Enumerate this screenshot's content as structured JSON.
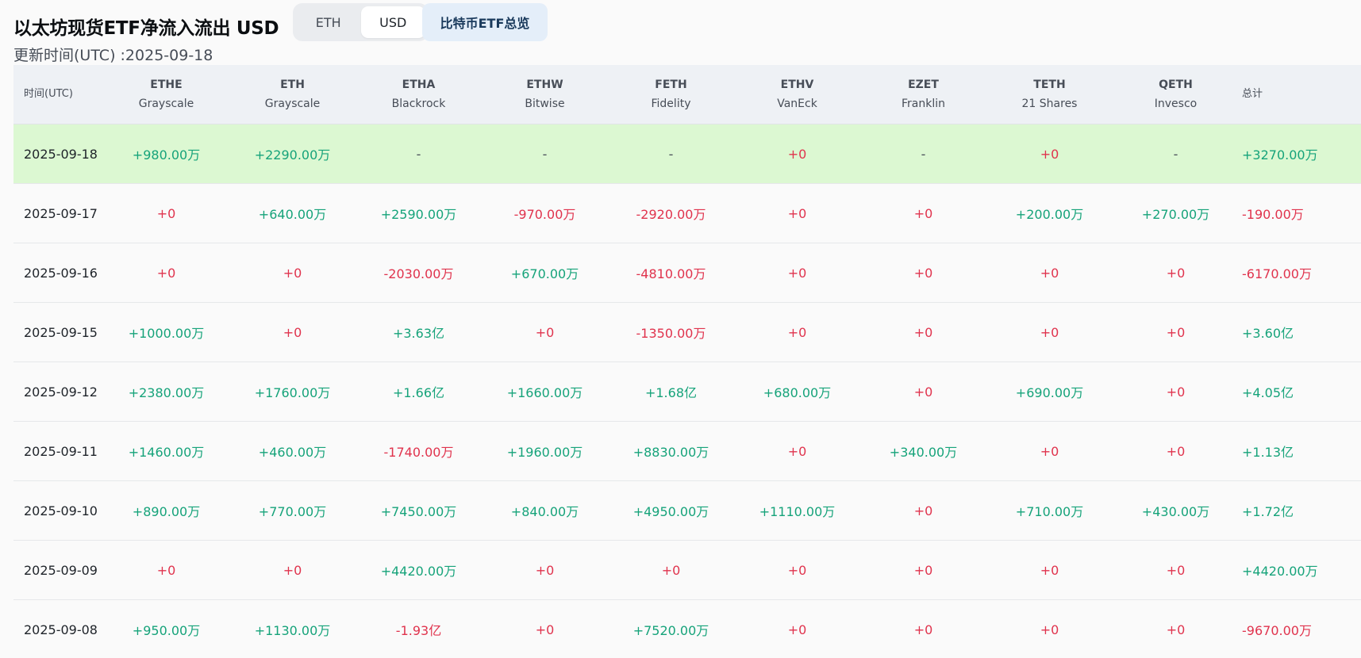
{
  "header": {
    "title": "以太坊现货ETF净流入流出 USD",
    "toggle": {
      "eth_label": "ETH",
      "usd_label": "USD",
      "active": "USD"
    },
    "btc_button_label": "比特币ETF总览",
    "updated_label": "更新时间(UTC) :2025-09-18"
  },
  "table": {
    "date_header": "时间(UTC)",
    "total_header": "总计",
    "columns": [
      {
        "ticker": "ETHE",
        "issuer": "Grayscale"
      },
      {
        "ticker": "ETH",
        "issuer": "Grayscale"
      },
      {
        "ticker": "ETHA",
        "issuer": "Blackrock"
      },
      {
        "ticker": "ETHW",
        "issuer": "Bitwise"
      },
      {
        "ticker": "FETH",
        "issuer": "Fidelity"
      },
      {
        "ticker": "ETHV",
        "issuer": "VanEck"
      },
      {
        "ticker": "EZET",
        "issuer": "Franklin"
      },
      {
        "ticker": "TETH",
        "issuer": "21 Shares"
      },
      {
        "ticker": "QETH",
        "issuer": "Invesco"
      }
    ],
    "rows": [
      {
        "date": "2025-09-18",
        "values": [
          "+980.00万",
          "+2290.00万",
          "-",
          "-",
          "-",
          "+0",
          "-",
          "+0",
          "-"
        ],
        "total": "+3270.00万"
      },
      {
        "date": "2025-09-17",
        "values": [
          "+0",
          "+640.00万",
          "+2590.00万",
          "-970.00万",
          "-2920.00万",
          "+0",
          "+0",
          "+200.00万",
          "+270.00万"
        ],
        "total": "-190.00万"
      },
      {
        "date": "2025-09-16",
        "values": [
          "+0",
          "+0",
          "-2030.00万",
          "+670.00万",
          "-4810.00万",
          "+0",
          "+0",
          "+0",
          "+0"
        ],
        "total": "-6170.00万"
      },
      {
        "date": "2025-09-15",
        "values": [
          "+1000.00万",
          "+0",
          "+3.63亿",
          "+0",
          "-1350.00万",
          "+0",
          "+0",
          "+0",
          "+0"
        ],
        "total": "+3.60亿"
      },
      {
        "date": "2025-09-12",
        "values": [
          "+2380.00万",
          "+1760.00万",
          "+1.66亿",
          "+1660.00万",
          "+1.68亿",
          "+680.00万",
          "+0",
          "+690.00万",
          "+0"
        ],
        "total": "+4.05亿"
      },
      {
        "date": "2025-09-11",
        "values": [
          "+1460.00万",
          "+460.00万",
          "-1740.00万",
          "+1960.00万",
          "+8830.00万",
          "+0",
          "+340.00万",
          "+0",
          "+0"
        ],
        "total": "+1.13亿"
      },
      {
        "date": "2025-09-10",
        "values": [
          "+890.00万",
          "+770.00万",
          "+7450.00万",
          "+840.00万",
          "+4950.00万",
          "+1110.00万",
          "+0",
          "+710.00万",
          "+430.00万"
        ],
        "total": "+1.72亿"
      },
      {
        "date": "2025-09-09",
        "values": [
          "+0",
          "+0",
          "+4420.00万",
          "+0",
          "+0",
          "+0",
          "+0",
          "+0",
          "+0"
        ],
        "total": "+4420.00万"
      },
      {
        "date": "2025-09-08",
        "values": [
          "+950.00万",
          "+1130.00万",
          "-1.93亿",
          "+0",
          "+7520.00万",
          "+0",
          "+0",
          "+0",
          "+0"
        ],
        "total": "-9670.00万"
      }
    ]
  },
  "colors": {
    "positive": "#16a37a",
    "negative": "#e0334d",
    "highlight_row": "#dcf8d2",
    "header_bg": "#eef1f5"
  }
}
